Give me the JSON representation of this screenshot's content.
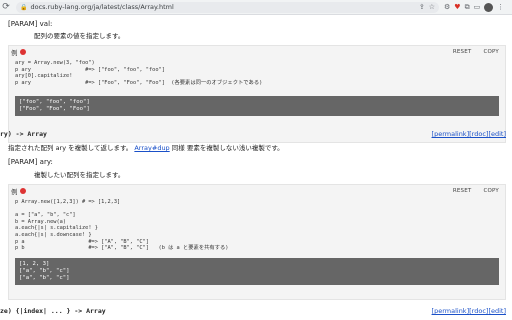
{
  "browser": {
    "url": "docs.ruby-lang.org/ja/latest/class/Array.html"
  },
  "section1": {
    "param_label": "[PARAM] val:",
    "param_desc": "配列の要素の値を指定します。",
    "example_label": "例",
    "reset": "RESET",
    "copy": "COPY",
    "code": "ary = Array.new(3, \"foo\")\np ary                 #=> [\"foo\", \"foo\", \"foo\"]\nary[0].capitalize!\np ary                 #=> [\"Foo\", \"Foo\", \"Foo\"]  (各要素は同一のオブジェクトである)",
    "output": "[\"foo\", \"foo\", \"foo\"]\n[\"Foo\", \"Foo\", \"Foo\"]"
  },
  "section2": {
    "signature": "ry) -> Array",
    "links": [
      "[permalink]",
      "[rdoc]",
      "[edit]"
    ],
    "desc_before": "指定された配列 ary を複製して返します。 ",
    "desc_link": "Array#dup",
    "desc_after": " 同様 要素を複製しない浅い複製です。",
    "param_label": "[PARAM] ary:",
    "param_desc": "複製したい配列を指定します。",
    "example_label": "例",
    "reset": "RESET",
    "copy": "COPY",
    "code": "p Array.new([1,2,3]) # => [1,2,3]\n\na = [\"a\", \"b\", \"c\"]\nb = Array.new(a)\na.each{|s| s.capitalize! }\na.each{|s| s.downcase! }\np a                    #=> [\"A\", \"B\", \"C\"]\np b                    #=> [\"A\", \"B\", \"C\"]   (b は a と要素を共有する)",
    "output": "[1, 2, 3]\n[\"a\", \"b\", \"c\"]\n[\"a\", \"b\", \"c\"]"
  },
  "section3": {
    "signature": "ze) {|index| ... } -> Array",
    "links": [
      "[permalink]",
      "[rdoc]",
      "[edit]"
    ]
  }
}
